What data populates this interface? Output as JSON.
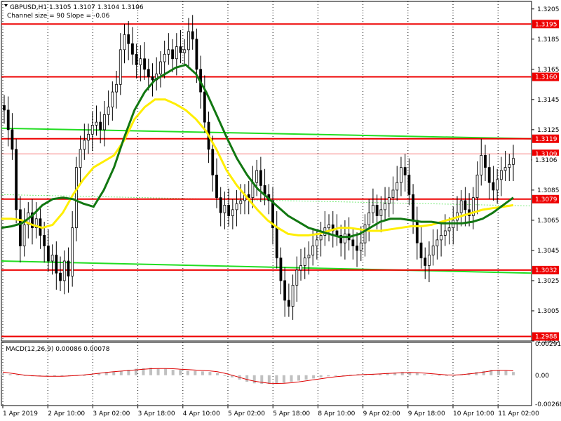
{
  "header": {
    "symbol_line": "GBPUSD,H1  1.3105 1.3107 1.3104 1.3106",
    "indicator_line": "Channel size = 90 Slope = -0.06"
  },
  "macd": {
    "label": "MACD(12,26,9) 0.00086 0.00078"
  },
  "chart_data": {
    "type": "candlestick",
    "symbol": "GBPUSD",
    "timeframe": "H1",
    "ohlc_last": {
      "open": 1.3105,
      "high": 1.3107,
      "low": 1.3104,
      "close": 1.3106
    },
    "current_price": "1.3106",
    "y_axis_ticks": [
      "1.3205",
      "1.3185",
      "1.3165",
      "1.3145",
      "1.3125",
      "1.3105",
      "1.3085",
      "1.3065",
      "1.3045",
      "1.3025",
      "1.3005",
      "1.2985"
    ],
    "ylim": [
      1.2985,
      1.321
    ],
    "x_axis_ticks": [
      "1 Apr 2019",
      "2 Apr 10:00",
      "3 Apr 02:00",
      "3 Apr 18:00",
      "4 Apr 10:00",
      "5 Apr 02:00",
      "5 Apr 18:00",
      "8 Apr 10:00",
      "9 Apr 02:00",
      "9 Apr 18:00",
      "10 Apr 10:00",
      "11 Apr 02:00"
    ],
    "levels": [
      {
        "price": 1.3195,
        "label": "1.3195"
      },
      {
        "price": 1.316,
        "label": "1.3160"
      },
      {
        "price": 1.3119,
        "label": "1.3119"
      },
      {
        "price": 1.3079,
        "label": "1.3079"
      },
      {
        "price": 1.3032,
        "label": "1.3032"
      },
      {
        "price": 1.2988,
        "label": "1.2988"
      }
    ],
    "hidden_level": {
      "price": 1.3109,
      "label": "1.3109"
    },
    "closes": [
      1.3138,
      1.3125,
      1.3112,
      1.3072,
      1.3048,
      1.3062,
      1.307,
      1.306,
      1.3066,
      1.3055,
      1.3048,
      1.3038,
      1.3042,
      1.303,
      1.3025,
      1.3038,
      1.3028,
      1.306,
      1.31,
      1.3112,
      1.3118,
      1.3122,
      1.3128,
      1.313,
      1.3125,
      1.3135,
      1.314,
      1.315,
      1.3155,
      1.3178,
      1.3188,
      1.3182,
      1.3175,
      1.3168,
      1.3172,
      1.3165,
      1.316,
      1.3158,
      1.3162,
      1.317,
      1.3175,
      1.3178,
      1.3172,
      1.318,
      1.3176,
      1.3178,
      1.319,
      1.3185,
      1.3165,
      1.315,
      1.313,
      1.3112,
      1.3095,
      1.308,
      1.307,
      1.3075,
      1.3068,
      1.3072,
      1.3076,
      1.3078,
      1.3082,
      1.308,
      1.309,
      1.3098,
      1.3088,
      1.3082,
      1.3078,
      1.306,
      1.304,
      1.3025,
      1.3012,
      1.3008,
      1.3022,
      1.3032,
      1.3035,
      1.304,
      1.3042,
      1.3048,
      1.3052,
      1.3055,
      1.306,
      1.3062,
      1.3058,
      1.3055,
      1.305,
      1.3056,
      1.3052,
      1.3048,
      1.3045,
      1.305,
      1.3062,
      1.307,
      1.3075,
      1.3068,
      1.3072,
      1.3076,
      1.308,
      1.3085,
      1.309,
      1.31,
      1.3095,
      1.3082,
      1.3065,
      1.305,
      1.304,
      1.3035,
      1.3042,
      1.3048,
      1.3052,
      1.3055,
      1.3058,
      1.306,
      1.3065,
      1.307,
      1.3078,
      1.3072,
      1.3068,
      1.308,
      1.3095,
      1.3108,
      1.31,
      1.309,
      1.3085,
      1.3092,
      1.3098,
      1.31,
      1.3102,
      1.3106
    ],
    "ma_green": [
      1.306,
      1.3061,
      1.3063,
      1.3068,
      1.3075,
      1.3079,
      1.308,
      1.3079,
      1.3076,
      1.3074,
      1.3085,
      1.31,
      1.312,
      1.3138,
      1.315,
      1.3158,
      1.3162,
      1.3166,
      1.3168,
      1.3162,
      1.315,
      1.3135,
      1.312,
      1.3106,
      1.3095,
      1.3086,
      1.308,
      1.3074,
      1.3068,
      1.3064,
      1.306,
      1.3058,
      1.3056,
      1.3054,
      1.3054,
      1.3056,
      1.306,
      1.3064,
      1.3066,
      1.3066,
      1.3065,
      1.3064,
      1.3064,
      1.3063,
      1.3063,
      1.3063,
      1.3064,
      1.3066,
      1.307,
      1.3075,
      1.308
    ],
    "ma_yellow": [
      1.3066,
      1.3066,
      1.3065,
      1.3062,
      1.306,
      1.3062,
      1.307,
      1.3082,
      1.3092,
      1.31,
      1.3104,
      1.3108,
      1.3118,
      1.3132,
      1.314,
      1.3145,
      1.3145,
      1.3142,
      1.3138,
      1.3132,
      1.3124,
      1.3112,
      1.3098,
      1.3088,
      1.308,
      1.3072,
      1.3065,
      1.306,
      1.3056,
      1.3055,
      1.3055,
      1.3056,
      1.3058,
      1.306,
      1.306,
      1.3059,
      1.3058,
      1.3058,
      1.3059,
      1.306,
      1.3061,
      1.3061,
      1.3062,
      1.3064,
      1.3066,
      1.3068,
      1.307,
      1.3072,
      1.3073,
      1.3074,
      1.3075
    ],
    "channel_upper": {
      "start": 1.3126,
      "end": 1.3119
    },
    "channel_lower": {
      "start": 1.3038,
      "end": 1.303
    },
    "macd_hist": [
      0.0002,
      0.0001,
      5e-05,
      -5e-05,
      -0.0001,
      -8e-05,
      -0.0001,
      -0.00012,
      -0.0001,
      -8e-05,
      -5e-05,
      0.0,
      0.0001,
      0.0002,
      0.0003,
      0.00035,
      0.0004,
      0.0005,
      0.0006,
      0.00065,
      0.0007,
      0.0006,
      0.0006,
      0.0005,
      0.0005,
      0.0004,
      0.0004,
      0.00035,
      0.0003,
      0.0002,
      0.0,
      -0.0002,
      -0.0004,
      -0.0006,
      -0.00075,
      -0.0008,
      -0.0008,
      -0.00075,
      -0.0007,
      -0.0006,
      -0.0005,
      -0.0004,
      -0.0003,
      -0.0002,
      -0.0001,
      -5e-05,
      0.0,
      5e-05,
      0.0001,
      0.0001,
      0.00012,
      0.00015,
      0.0002,
      0.00025,
      0.0003,
      0.00025,
      0.0002,
      0.0001,
      5e-05,
      0.0,
      -5e-05,
      0.0,
      0.0001,
      0.0002,
      0.0003,
      0.0004,
      0.0005,
      0.0005,
      0.0004,
      0.0003
    ],
    "macd_signal": [
      0.0003,
      0.0002,
      0.0001,
      0.0,
      -5e-05,
      -8e-05,
      -0.0001,
      -0.0001,
      -9e-05,
      -6e-05,
      -2e-05,
      3e-05,
      0.0001,
      0.00018,
      0.00026,
      0.00032,
      0.00038,
      0.00044,
      0.0005,
      0.00056,
      0.0006,
      0.00062,
      0.00062,
      0.0006,
      0.00056,
      0.00052,
      0.00048,
      0.00044,
      0.0004,
      0.00032,
      0.00018,
      0.0,
      -0.0002,
      -0.0004,
      -0.00055,
      -0.00066,
      -0.00074,
      -0.00076,
      -0.00074,
      -0.0007,
      -0.00062,
      -0.00052,
      -0.00042,
      -0.00032,
      -0.00022,
      -0.00014,
      -8e-05,
      -2e-05,
      3e-05,
      6e-05,
      9e-05,
      0.00012,
      0.00016,
      0.0002,
      0.00024,
      0.00025,
      0.00024,
      0.0002,
      0.00014,
      8e-05,
      3e-05,
      2e-05,
      5e-05,
      0.00012,
      0.0002,
      0.0003,
      0.0004,
      0.00045,
      0.00045,
      0.0004
    ],
    "macd_ticks": [
      "0.00291",
      "0.00",
      "-0.00268"
    ],
    "macd_ylim": [
      -0.00268,
      0.00291
    ]
  }
}
